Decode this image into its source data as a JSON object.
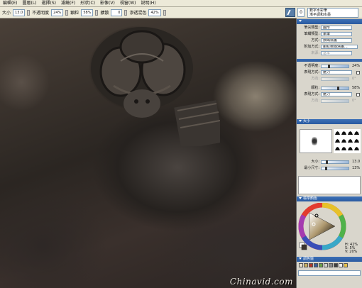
{
  "menubar": {
    "items": [
      "編輯(E)",
      "圖層(L)",
      "選擇(S)",
      "濾鏡(F)",
      "形狀(C)",
      "影像(V)",
      "視窗(W)",
      "說明(H)"
    ]
  },
  "propbar": {
    "size_label": "大小",
    "size_value": "13.0",
    "opacity_label": "不透明度",
    "opacity_value": "24%",
    "grain_label": "顆粒",
    "grain_value": "58%",
    "expand_label": "擴散",
    "expand_value": "0",
    "blend_label": "渗透混色",
    "blend_value": "42%"
  },
  "toptools": {
    "brush_size": "0",
    "stroke_line1": "數字水彩筆",
    "stroke_line2": "漸平調和水墨"
  },
  "panel": {
    "rows": {
      "stroke_type_label": "筆尖類型:",
      "stroke_type_value": "圓形",
      "stroke_category_label": "筆觸類型:",
      "stroke_category_value": "單筆",
      "method_label": "方式:",
      "method_value": "數碼濕畫",
      "sub_method_label": "附加方式:",
      "sub_method_value": "顆粒數碼濕畫...",
      "source_label": "來源:",
      "source_value": "基本"
    },
    "opacity_label": "不透明度:",
    "opacity_value": "24%",
    "expression_label": "表現方式:",
    "expression_value": "壓力",
    "direction_label": "方向:",
    "direction_value": "0°",
    "grain_label": "顆粒:",
    "grain_value": "58%",
    "expression2_label": "表現方式:",
    "expression2_value": "壓力",
    "direction2_label": "方向:",
    "direction2_value": "0°",
    "size_section_title": "大小",
    "size_label": "大小:",
    "size_value": "13.0",
    "min_size_label": "最小尺寸:",
    "min_size_value": "13%",
    "color_section_title": "標準顏色",
    "color_h": "H: 42%",
    "color_s": "S: 5%",
    "color_v": "V: 20%",
    "swatch_section_title": "調色盤",
    "swatch_colors": [
      "#e8e0c8",
      "#c8b060",
      "#b0382a",
      "#3a5f9a",
      "#6aa04a",
      "#d0d0d0",
      "#888888",
      "#404040",
      "#f0f0f0",
      "#e6c14a"
    ]
  },
  "watermark": "Chinavid.com"
}
